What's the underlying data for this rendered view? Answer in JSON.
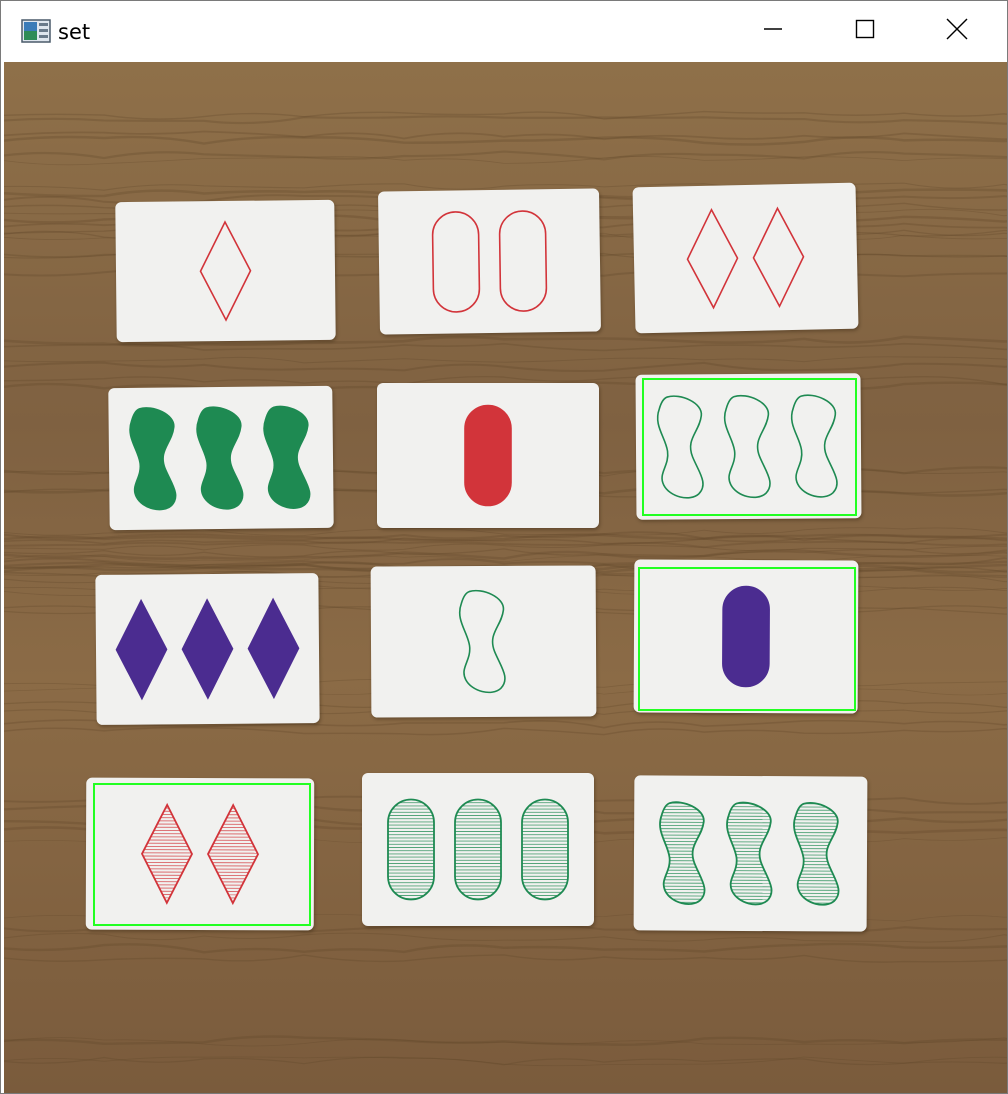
{
  "window": {
    "title": "set",
    "app_icon": "image-window-icon",
    "controls": [
      "minimize-icon",
      "maximize-icon",
      "close-icon"
    ]
  },
  "colors": {
    "table_wood": "#8a6a45",
    "card": "#f1f1ef",
    "red": "#d2343a",
    "green": "#1e8a52",
    "purple": "#4b2c90",
    "highlight": "#22ff22"
  },
  "cards": [
    {
      "id": 1,
      "count": 1,
      "shape": "diamond",
      "color": "red",
      "shading": "open",
      "highlighted": false
    },
    {
      "id": 2,
      "count": 2,
      "shape": "oval",
      "color": "red",
      "shading": "open",
      "highlighted": false
    },
    {
      "id": 3,
      "count": 2,
      "shape": "diamond",
      "color": "red",
      "shading": "open",
      "highlighted": false
    },
    {
      "id": 4,
      "count": 3,
      "shape": "squiggle",
      "color": "green",
      "shading": "solid",
      "highlighted": false
    },
    {
      "id": 5,
      "count": 1,
      "shape": "oval",
      "color": "red",
      "shading": "solid",
      "highlighted": false
    },
    {
      "id": 6,
      "count": 3,
      "shape": "squiggle",
      "color": "green",
      "shading": "open",
      "highlighted": true
    },
    {
      "id": 7,
      "count": 3,
      "shape": "diamond",
      "color": "purple",
      "shading": "solid",
      "highlighted": false
    },
    {
      "id": 8,
      "count": 1,
      "shape": "squiggle",
      "color": "green",
      "shading": "open",
      "highlighted": false
    },
    {
      "id": 9,
      "count": 1,
      "shape": "oval",
      "color": "purple",
      "shading": "solid",
      "highlighted": true
    },
    {
      "id": 10,
      "count": 2,
      "shape": "diamond",
      "color": "red",
      "shading": "striped",
      "highlighted": true
    },
    {
      "id": 11,
      "count": 3,
      "shape": "oval",
      "color": "green",
      "shading": "striped",
      "highlighted": false
    },
    {
      "id": 12,
      "count": 3,
      "shape": "squiggle",
      "color": "green",
      "shading": "striped",
      "highlighted": false
    }
  ]
}
